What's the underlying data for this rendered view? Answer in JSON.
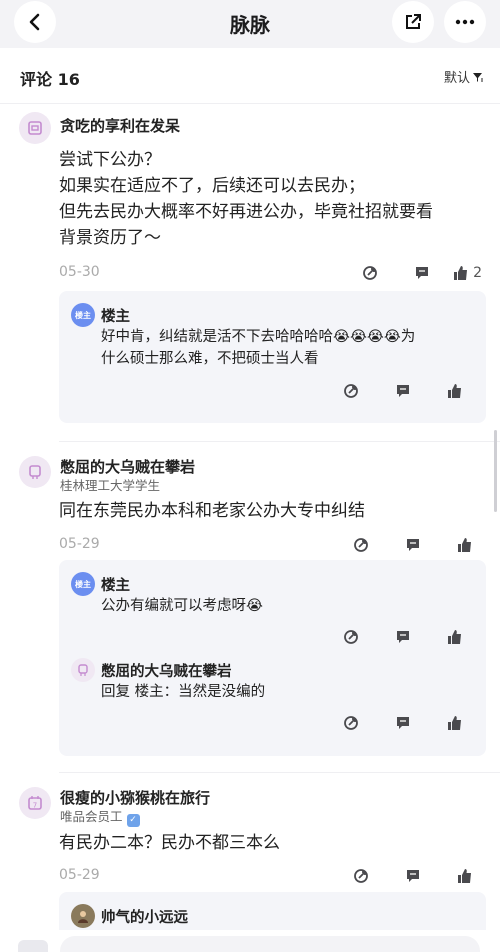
{
  "header": {
    "title": "脉脉",
    "back_icon": "chevron-left-icon",
    "share_icon": "share-icon",
    "more_icon": "more-horizontal-icon"
  },
  "comments_header": {
    "label": "评论 16",
    "sort_label": "默认"
  },
  "comments": [
    {
      "author": "贪吃的享利在发呆",
      "subtitle": "",
      "body_lines": [
        "尝试下公办？",
        "如果实在适应不了，后续还可以去民办；",
        "但先去民办大概率不好再进公办，毕竟社招就要看",
        "背景资历了～"
      ],
      "date": "05-30",
      "likes": "2",
      "replies": [
        {
          "badge": "楼主",
          "author": "楼主",
          "text_lines": [
            "好中肯，纠结就是活不下去哈哈哈哈😭😭😭😭为",
            "什么硕士那么难，不把硕士当人看"
          ]
        }
      ]
    },
    {
      "author": "憋屈的大乌贼在攀岩",
      "subtitle": "桂林理工大学学生",
      "body_lines": [
        "同在东莞民办本科和老家公办大专中纠结"
      ],
      "date": "05-29",
      "likes": "",
      "replies": [
        {
          "badge": "楼主",
          "author": "楼主",
          "text_lines": [
            "公办有编就可以考虑呀😭"
          ]
        },
        {
          "badge": "",
          "author": "憋屈的大乌贼在攀岩",
          "text_lines": [
            "回复 楼主：当然是没编的"
          ]
        }
      ]
    },
    {
      "author": "很瘦的小猕猴桃在旅行",
      "subtitle": "唯品会员工",
      "body_lines": [
        "有民办二本？民办不都三本么"
      ],
      "date": "05-29",
      "likes": "",
      "replies": [
        {
          "badge": "",
          "author": "帅气的小远远",
          "text_lines": []
        }
      ]
    }
  ],
  "icons": {
    "repost": "repost-icon",
    "comment": "comment-icon",
    "like": "thumbs-up-icon",
    "filter": "filter-icon"
  },
  "colors": {
    "topbar": "#f3f3f6",
    "reply_bg": "#f4f5f9",
    "louzhu_badge": "#6b8ef0",
    "icon_gray": "#4a4a4e"
  }
}
